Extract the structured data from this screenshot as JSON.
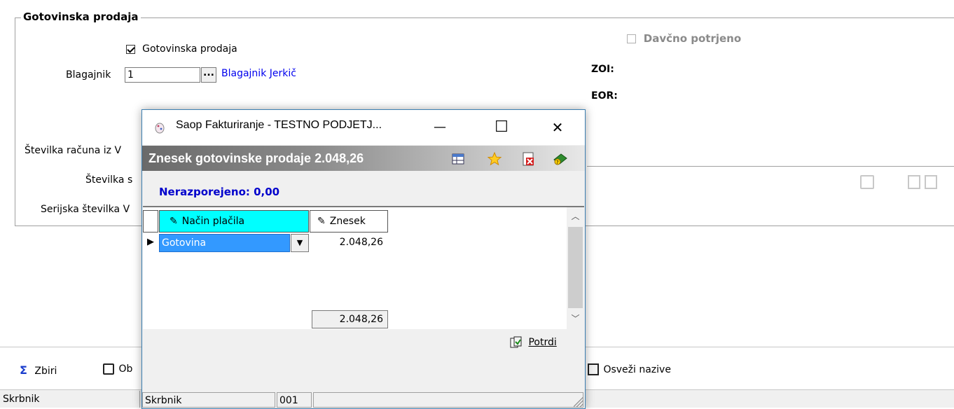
{
  "group": {
    "title": "Gotovinska prodaja",
    "checkbox_label": "Gotovinska prodaja",
    "checkbox_checked": true,
    "blagajnik_label": "Blagajnik",
    "blagajnik_value": "1",
    "blagajnik_browse": "...",
    "blagajnik_name": "Blagajnik Jerkič",
    "stevilka_racuna_label": "Številka računa iz V",
    "stevilka_s_label": "Številka s",
    "serijska_label": "Serijska številka V",
    "davcno_label": "Davčno potrjeno",
    "zoi_label": "ZOI:",
    "eor_label": "EOR:"
  },
  "toolbar": {
    "zbiri_label": "Zbiri",
    "ob_label": "Ob",
    "osvezi_label": "Osveži nazive"
  },
  "statusbar": {
    "skrbnik_label": "Skrbnik",
    "skrbnik_value": "001"
  },
  "dialog": {
    "title": "Saop Fakturiranje - TESTNO PODJETJ...",
    "minimize": "—",
    "maximize": "☐",
    "close": "✕",
    "header": "Znesek gotovinske prodaje 2.048,26",
    "nerazporejeno": "Nerazporejeno: 0,00",
    "columns": {
      "nacin": "Način plačila",
      "znesek": "Znesek"
    },
    "row": {
      "nacin": "Gotovina",
      "znesek": "2.048,26"
    },
    "total": "2.048,26",
    "potrdi_label": "Potrdi",
    "status": {
      "skrbnik_label": "Skrbnik",
      "skrbnik_value": "001"
    }
  }
}
